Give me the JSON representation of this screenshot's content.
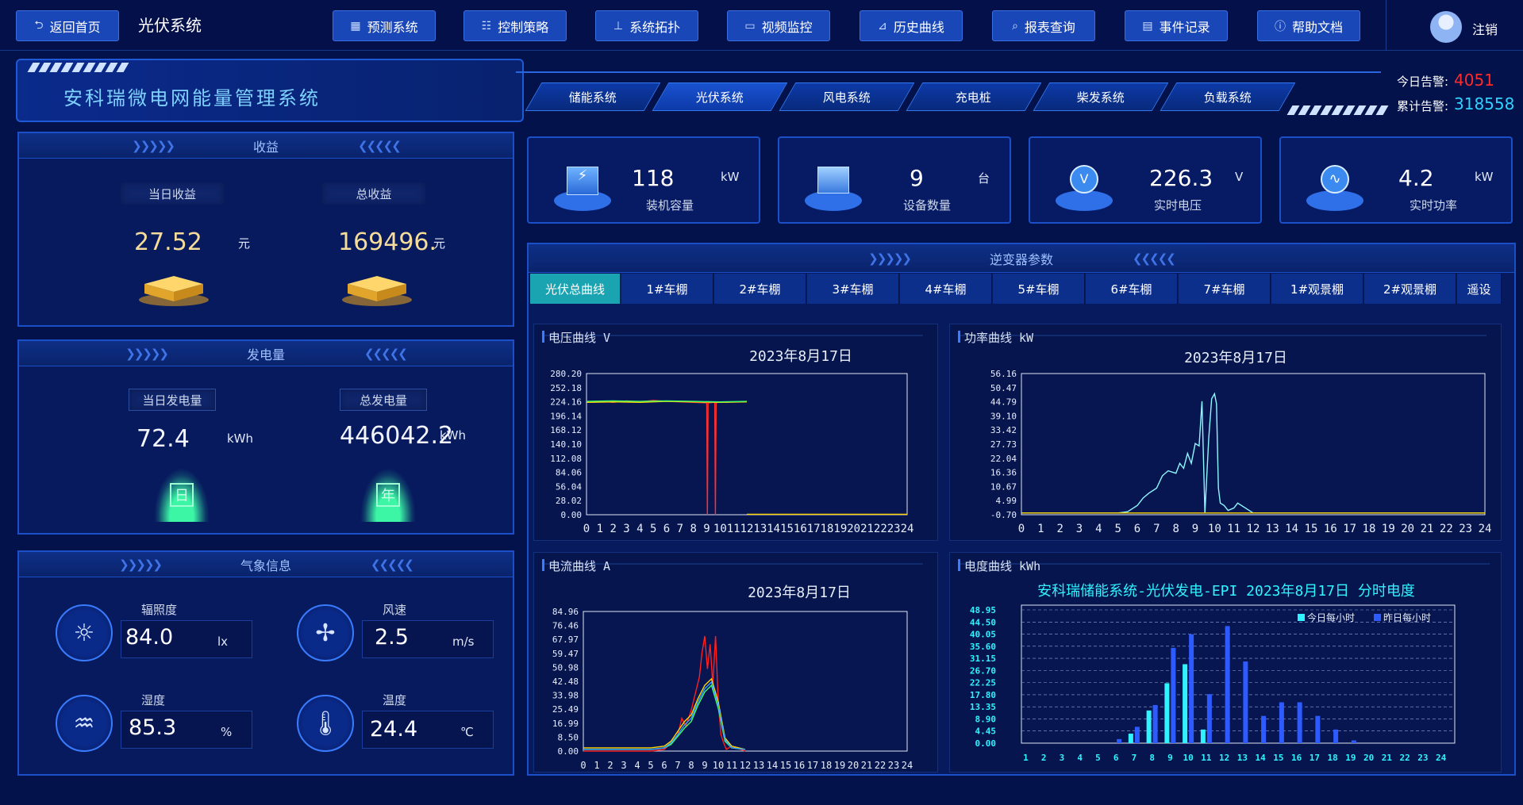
{
  "topbar": {
    "back_label": "返回首页",
    "page_label": "光伏系统",
    "nav": [
      "预测系统",
      "控制策略",
      "系统拓扑",
      "视频监控",
      "历史曲线",
      "报表查询",
      "事件记录",
      "帮助文档"
    ],
    "logout_label": "注销"
  },
  "header": {
    "system_title": "安科瑞微电网能量管理系统",
    "subsystem_tabs": [
      "储能系统",
      "光伏系统",
      "风电系统",
      "充电桩",
      "柴发系统",
      "负载系统"
    ],
    "alarm_today_label": "今日告警:",
    "alarm_today_value": "4051",
    "alarm_total_label": "累计告警:",
    "alarm_total_value": "318558"
  },
  "income": {
    "title": "收益",
    "today_label": "当日收益",
    "today_value": "27.52",
    "today_unit": "元",
    "total_label": "总收益",
    "total_value": "169496.",
    "total_unit": "元"
  },
  "generation": {
    "title": "发电量",
    "today_label": "当日发电量",
    "today_value": "72.4",
    "today_unit": "kWh",
    "today_icon": "日",
    "total_label": "总发电量",
    "total_value": "446042.2",
    "total_unit": "kWh",
    "total_icon": "年"
  },
  "weather": {
    "title": "气象信息",
    "irradiance_label": "辐照度",
    "irradiance_value": "84.0",
    "irradiance_unit": "lx",
    "wind_label": "风速",
    "wind_value": "2.5",
    "wind_unit": "m/s",
    "humidity_label": "湿度",
    "humidity_value": "85.3",
    "humidity_unit": "%",
    "temperature_label": "温度",
    "temperature_value": "24.4",
    "temperature_unit": "℃"
  },
  "stats": [
    {
      "value": "118",
      "unit": "kW",
      "label": "装机容量",
      "icon": "solar-panel-icon"
    },
    {
      "value": "9",
      "unit": "台",
      "label": "设备数量",
      "icon": "device-icon"
    },
    {
      "value": "226.3",
      "unit": "V",
      "label": "实时电压",
      "icon": "gauge-icon"
    },
    {
      "value": "4.2",
      "unit": "kW",
      "label": "实时功率",
      "icon": "pulse-icon"
    }
  ],
  "inverter": {
    "title": "逆变器参数",
    "tabs": [
      "光伏总曲线",
      "1#车棚",
      "2#车棚",
      "3#车棚",
      "4#车棚",
      "5#车棚",
      "6#车棚",
      "7#车棚",
      "1#观景棚",
      "2#观景棚",
      "遥设"
    ]
  },
  "colors": {
    "accent": "#1a47b8",
    "alarm_today": "#ff2b2b",
    "alarm_total": "#2fd3ff",
    "active_tab": "#1aa3b0"
  },
  "chart_data": [
    {
      "id": "voltage",
      "type": "line",
      "title": "电压曲线 V",
      "subtitle": "2023年8月17日",
      "x_ticks": [
        "0",
        "1",
        "2",
        "3",
        "4",
        "5",
        "6",
        "7",
        "8",
        "9",
        "10",
        "11",
        "12",
        "13",
        "14",
        "15",
        "16",
        "17",
        "18",
        "19",
        "20",
        "21",
        "22",
        "23",
        "24"
      ],
      "y_ticks": [
        "280.20",
        "252.18",
        "224.16",
        "196.14",
        "168.12",
        "140.10",
        "112.08",
        "84.06",
        "56.04",
        "28.02",
        "0.00"
      ],
      "ylim": [
        0,
        280.2
      ],
      "series": [
        {
          "color": "#ff3030",
          "x": [
            0,
            1,
            2,
            3,
            4,
            5,
            6,
            7,
            8,
            9,
            9.05,
            9.1,
            9.5,
            9.6,
            9.65,
            9.7,
            10,
            10.05,
            10.1,
            10.5,
            11,
            12
          ],
          "y": [
            224,
            225,
            223,
            226,
            224,
            227,
            225,
            224,
            223,
            222,
            0,
            222,
            223,
            223,
            0,
            222,
            224,
            223,
            224,
            223,
            224,
            224
          ]
        },
        {
          "color": "#ffd400",
          "x": [
            0,
            2,
            4,
            6,
            8,
            10,
            12
          ],
          "y": [
            223,
            224,
            223,
            225,
            224,
            223,
            224
          ]
        },
        {
          "color": "#3cff6a",
          "x": [
            0,
            2,
            4,
            6,
            8,
            10,
            12
          ],
          "y": [
            225,
            226,
            225,
            226,
            225,
            224,
            225
          ]
        },
        {
          "color": "#ffd400",
          "x": [
            12,
            24
          ],
          "y": [
            1,
            1
          ]
        }
      ]
    },
    {
      "id": "power",
      "type": "line",
      "title": "功率曲线 kW",
      "subtitle": "2023年8月17日",
      "x_ticks": [
        "0",
        "1",
        "2",
        "3",
        "4",
        "5",
        "6",
        "7",
        "8",
        "9",
        "10",
        "11",
        "12",
        "13",
        "14",
        "15",
        "16",
        "17",
        "18",
        "19",
        "20",
        "21",
        "22",
        "23",
        "24"
      ],
      "y_ticks": [
        "56.16",
        "50.47",
        "44.79",
        "39.10",
        "33.42",
        "27.73",
        "22.04",
        "16.36",
        "10.67",
        "4.99",
        "-0.70"
      ],
      "ylim": [
        -0.7,
        56.16
      ],
      "series": [
        {
          "color": "#8ff7ff",
          "x": [
            0,
            5,
            5.5,
            6,
            6.3,
            6.6,
            7,
            7.3,
            7.6,
            8,
            8.2,
            8.4,
            8.6,
            8.8,
            9,
            9.2,
            9.35,
            9.5,
            9.7,
            9.85,
            10,
            10.1,
            10.2,
            10.3,
            10.5,
            10.7,
            11,
            11.2,
            12,
            24
          ],
          "y": [
            0,
            0,
            0.5,
            3,
            6,
            8,
            10,
            15,
            17,
            16,
            20,
            18,
            24,
            20,
            28,
            27,
            45,
            0,
            30,
            46,
            48,
            44,
            10,
            4,
            3,
            1,
            2,
            4,
            0,
            0
          ]
        },
        {
          "color": "#ffd400",
          "x": [
            0,
            24
          ],
          "y": [
            0,
            0
          ]
        }
      ]
    },
    {
      "id": "current",
      "type": "line",
      "title": "电流曲线 A",
      "subtitle": "2023年8月17日",
      "x_ticks": [
        "0",
        "1",
        "2",
        "3",
        "4",
        "5",
        "6",
        "7",
        "8",
        "9",
        "10",
        "11",
        "12",
        "13",
        "14",
        "15",
        "16",
        "17",
        "18",
        "19",
        "20",
        "21",
        "22",
        "23",
        "24"
      ],
      "y_ticks": [
        "84.96",
        "76.46",
        "67.97",
        "59.47",
        "50.98",
        "42.48",
        "33.98",
        "25.49",
        "16.99",
        "8.50",
        "0.00"
      ],
      "ylim": [
        0,
        84.96
      ],
      "series": [
        {
          "color": "#ff2020",
          "x": [
            0,
            5,
            6,
            6.5,
            7,
            7.3,
            7.6,
            8,
            8.3,
            8.6,
            8.8,
            9,
            9.2,
            9.4,
            9.6,
            9.8,
            10,
            10.2,
            10.4,
            10.6,
            11,
            12
          ],
          "y": [
            0,
            0,
            1,
            5,
            10,
            20,
            15,
            25,
            35,
            45,
            60,
            70,
            50,
            65,
            40,
            70,
            30,
            10,
            5,
            1,
            3,
            0
          ]
        },
        {
          "color": "#ffd400",
          "x": [
            0,
            5,
            6,
            6.5,
            7,
            7.5,
            8,
            8.5,
            9,
            9.5,
            10,
            10.5,
            11,
            12
          ],
          "y": [
            2,
            2,
            3,
            6,
            12,
            18,
            22,
            32,
            40,
            44,
            30,
            8,
            3,
            1
          ]
        },
        {
          "color": "#3cff6a",
          "x": [
            0,
            5,
            6,
            6.5,
            7,
            7.5,
            8,
            8.5,
            9,
            9.5,
            10,
            10.5,
            11,
            12
          ],
          "y": [
            1,
            1,
            2,
            4,
            9,
            14,
            18,
            28,
            36,
            40,
            26,
            6,
            2,
            1
          ]
        },
        {
          "color": "#3aa0ff",
          "x": [
            0,
            5,
            6,
            6.5,
            7,
            7.5,
            8,
            8.5,
            9,
            9.5,
            10,
            10.5,
            11,
            12
          ],
          "y": [
            1,
            1,
            2,
            5,
            10,
            16,
            20,
            30,
            38,
            42,
            28,
            7,
            2,
            1
          ]
        }
      ]
    },
    {
      "id": "energy",
      "type": "bar",
      "title": "电度曲线 kWh",
      "subtitle": "安科瑞储能系统-光伏发电-EPI 2023年8月17日 分时电度",
      "categories": [
        "1",
        "2",
        "3",
        "4",
        "5",
        "6",
        "7",
        "8",
        "9",
        "10",
        "11",
        "12",
        "13",
        "14",
        "15",
        "16",
        "17",
        "18",
        "19",
        "20",
        "21",
        "22",
        "23",
        "24"
      ],
      "y_ticks": [
        "48.95",
        "44.50",
        "40.05",
        "35.60",
        "31.15",
        "26.70",
        "22.25",
        "17.80",
        "13.35",
        "8.90",
        "4.45",
        "0.00"
      ],
      "ylim": [
        0,
        48.95
      ],
      "series": [
        {
          "name": "今日每小时",
          "color": "#2ff3ff",
          "values": [
            0,
            0,
            0,
            0,
            0,
            0,
            3.5,
            12,
            22,
            29,
            5,
            0,
            0,
            0,
            0,
            0,
            0,
            0,
            0,
            0,
            0,
            0,
            0,
            0
          ]
        },
        {
          "name": "昨日每小时",
          "color": "#2d5bff",
          "values": [
            0,
            0,
            0,
            0,
            0,
            1.5,
            6,
            14,
            35,
            40,
            18,
            43,
            30,
            10,
            15,
            15,
            10,
            5,
            1,
            0,
            0,
            0,
            0,
            0
          ]
        }
      ]
    }
  ]
}
